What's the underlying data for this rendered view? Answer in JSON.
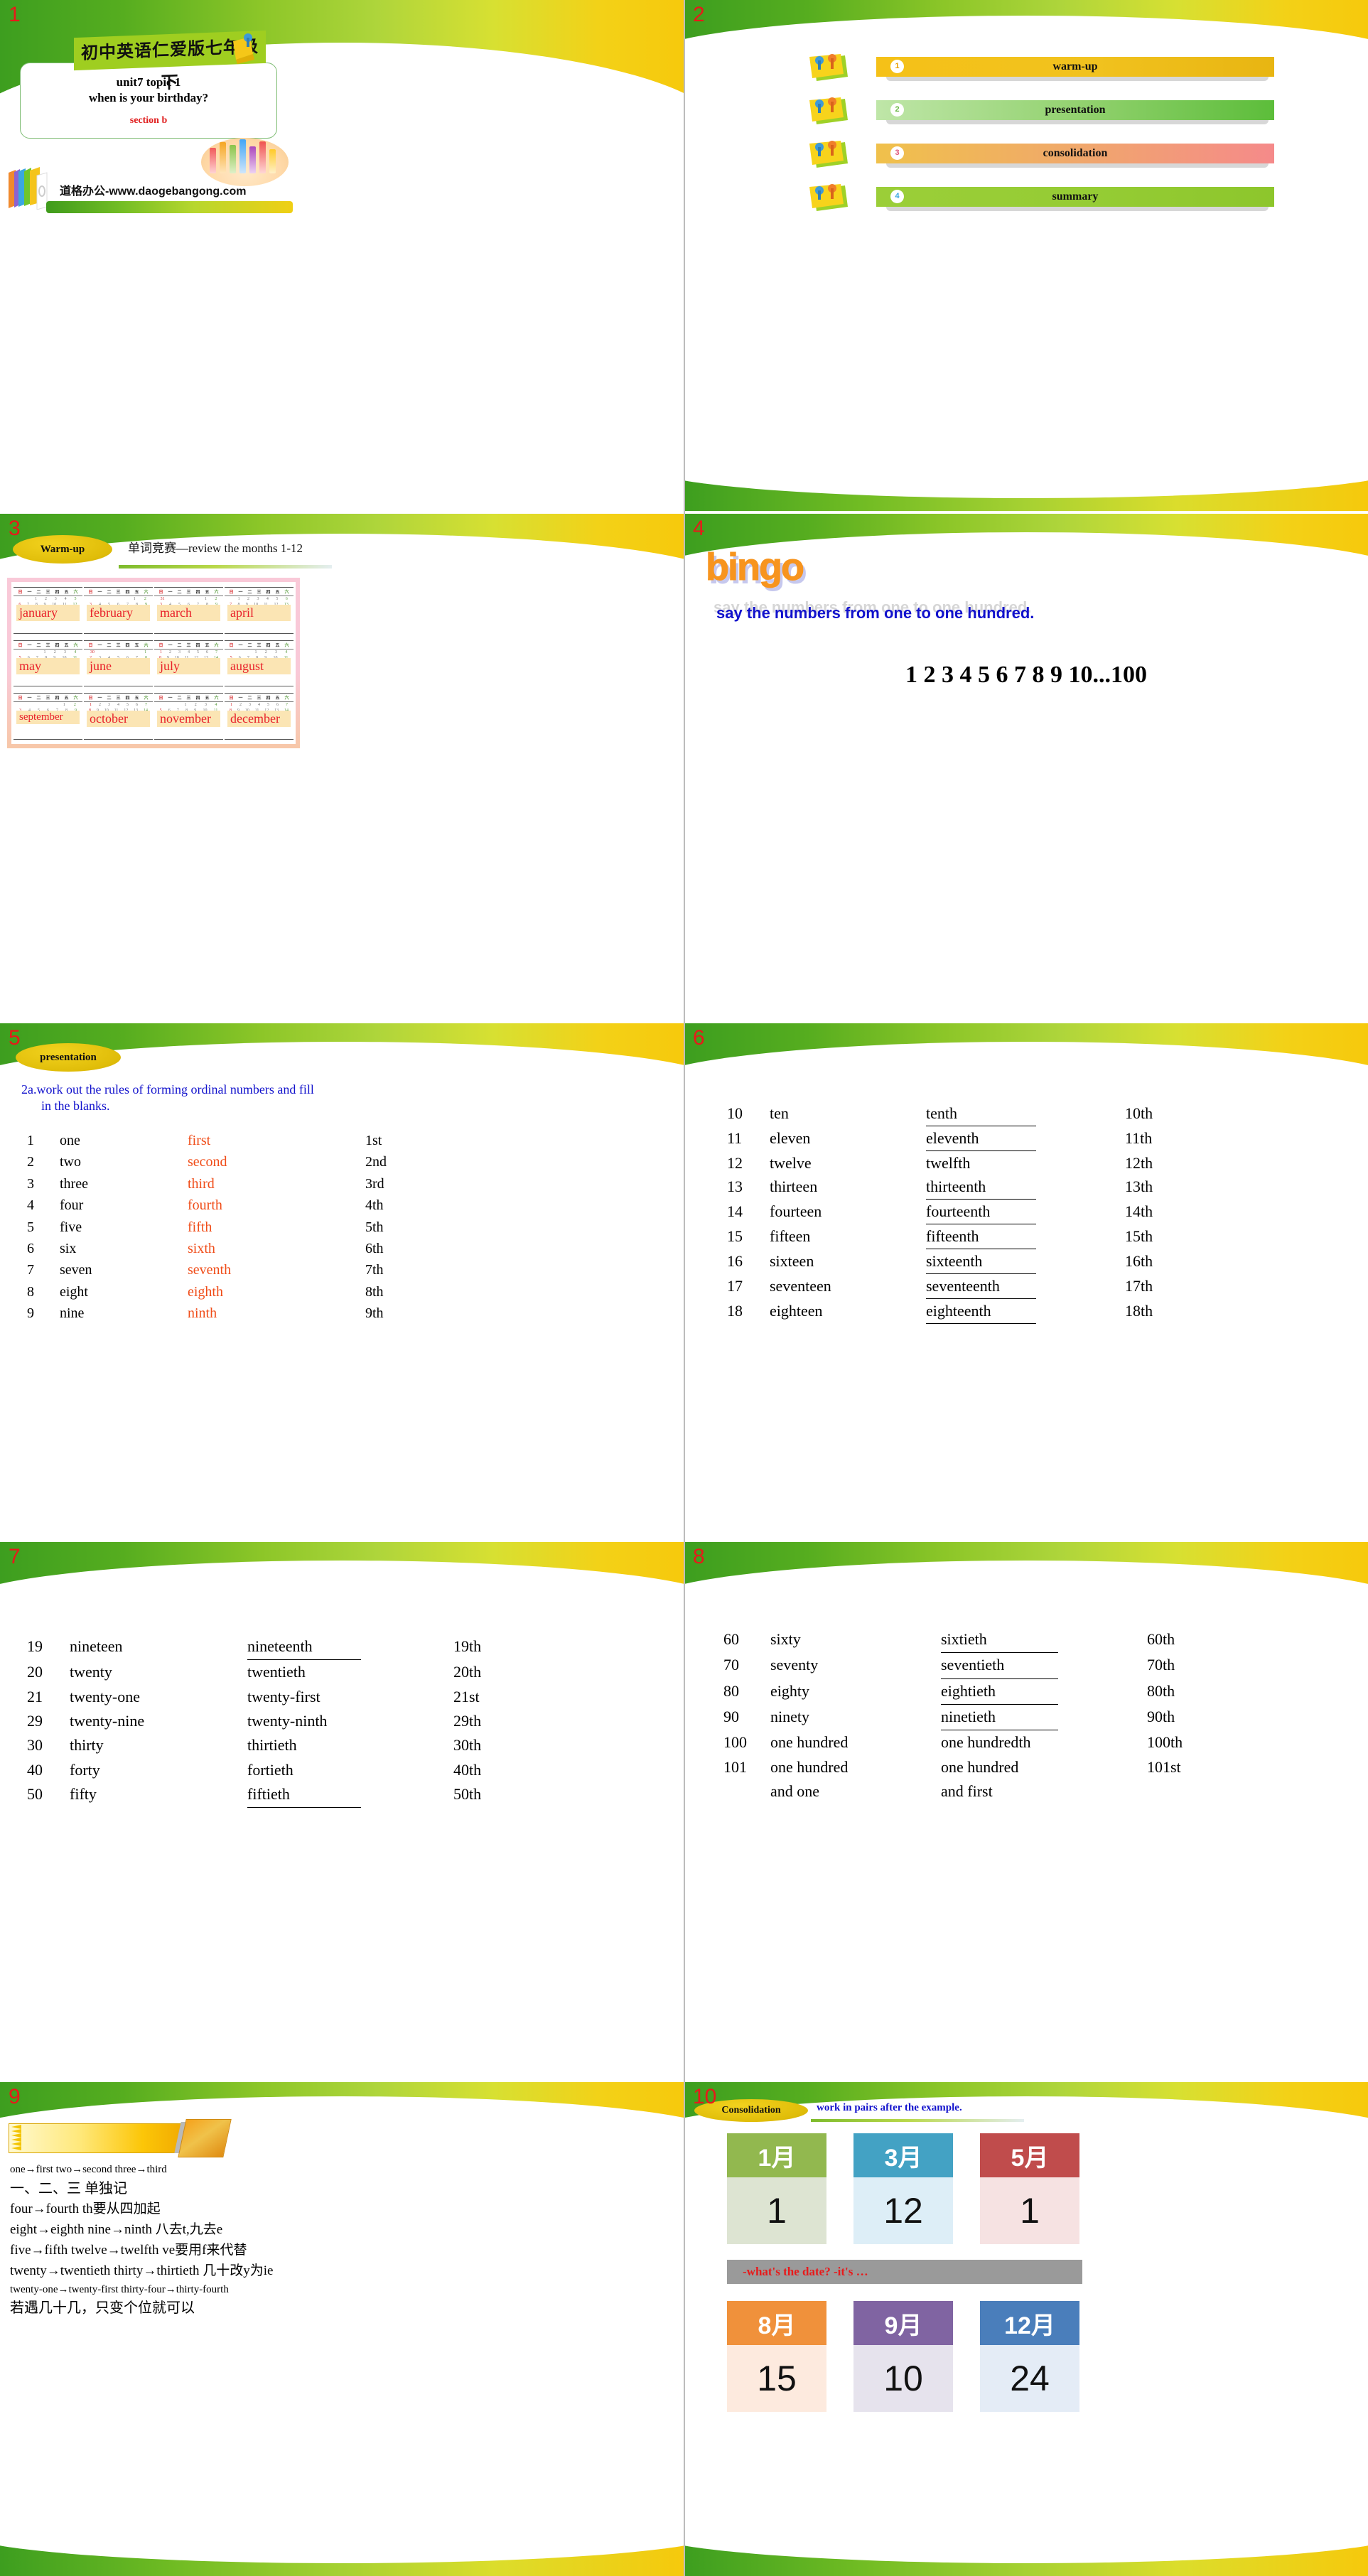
{
  "deck": {
    "watermark": "道格办公-www.daogebangong.com"
  },
  "slide1": {
    "number": "1",
    "banner": "初中英语仁爱版七年级下",
    "line1": "unit7 topic 1",
    "line2": "when is your birthday?",
    "line3": "section b"
  },
  "slide2": {
    "number": "2",
    "items": [
      {
        "num": "1",
        "label": "warm-up"
      },
      {
        "num": "2",
        "label": "presentation"
      },
      {
        "num": "3",
        "label": "consolidation"
      },
      {
        "num": "4",
        "label": "summary"
      }
    ]
  },
  "slide3": {
    "number": "3",
    "title": "Warm-up",
    "subtitle": "单词竞赛—review the months 1-12",
    "weekdays": [
      "日",
      "一",
      "二",
      "三",
      "四",
      "五",
      "六"
    ],
    "months": [
      {
        "label": "january",
        "days": [
          "",
          "",
          "1",
          "2",
          "3",
          "4",
          "5"
        ],
        "days2": [
          "6",
          "7",
          "8",
          "9",
          "10",
          "11",
          "12"
        ]
      },
      {
        "label": "february",
        "days": [
          "",
          "",
          "",
          "",
          "",
          "1",
          "2"
        ],
        "days2": [
          "3",
          "4",
          "5",
          "6",
          "7",
          "8",
          "9"
        ]
      },
      {
        "label": "march",
        "days": [
          "31",
          "",
          "",
          "",
          "",
          "1",
          "2"
        ],
        "days2": [
          "3",
          "4",
          "5",
          "6",
          "7",
          "8",
          "9"
        ]
      },
      {
        "label": "april",
        "days": [
          "",
          "1",
          "2",
          "3",
          "4",
          "5",
          "6"
        ],
        "days2": [
          "7",
          "8",
          "9",
          "10",
          "11",
          "12",
          "13"
        ]
      },
      {
        "label": "may",
        "days": [
          "",
          "",
          "",
          "1",
          "2",
          "3",
          "4"
        ],
        "days2": [
          "5",
          "6",
          "7",
          "8",
          "9",
          "10",
          "11"
        ]
      },
      {
        "label": "june",
        "days": [
          "30",
          "",
          "",
          "",
          "",
          "",
          "1"
        ],
        "days2": [
          "2",
          "3",
          "4",
          "5",
          "6",
          "7",
          "8"
        ]
      },
      {
        "label": "july",
        "days": [
          "1",
          "2",
          "3",
          "4",
          "5",
          "6",
          "7"
        ],
        "days2": [
          "8",
          "9",
          "10",
          "11",
          "12",
          "13",
          "14"
        ]
      },
      {
        "label": "august",
        "days": [
          "",
          "",
          "",
          "1",
          "2",
          "3",
          "4"
        ],
        "days2": [
          "5",
          "6",
          "7",
          "8",
          "9",
          "10",
          "11"
        ]
      },
      {
        "label": "september",
        "days": [
          "",
          "",
          "",
          "",
          "",
          "1",
          "2"
        ],
        "days2": [
          "3",
          "4",
          "5",
          "6",
          "7",
          "8",
          "9"
        ]
      },
      {
        "label": "october",
        "days": [
          "1",
          "2",
          "3",
          "4",
          "5",
          "6",
          "7"
        ],
        "days2": [
          "8",
          "9",
          "10",
          "11",
          "12",
          "13",
          "14"
        ]
      },
      {
        "label": "november",
        "days": [
          "",
          "",
          "",
          "1",
          "2",
          "3",
          "4"
        ],
        "days2": [
          "5",
          "6",
          "7",
          "8",
          "9",
          "10",
          "11"
        ]
      },
      {
        "label": "december",
        "days": [
          "1",
          "2",
          "3",
          "4",
          "5",
          "6",
          "7"
        ],
        "days2": [
          "8",
          "9",
          "10",
          "11",
          "12",
          "13",
          "14"
        ]
      }
    ]
  },
  "slide4": {
    "number": "4",
    "title": "bingo",
    "instruction": "say the numbers from one to one hundred.",
    "numbers": "1 2 3 4 5 6 7 8 9 10...100"
  },
  "slide5": {
    "number": "5",
    "title": "presentation",
    "instruction_line1": "2a.work out the rules of forming ordinal numbers and fill",
    "instruction_line2": "in the blanks.",
    "rows": [
      {
        "n": "1",
        "word": "one",
        "ordinal": "first",
        "abbr": "1st",
        "underline": false
      },
      {
        "n": "2",
        "word": "two",
        "ordinal": "second",
        "abbr": "2nd",
        "underline": false
      },
      {
        "n": "3",
        "word": "three",
        "ordinal": "third",
        "abbr": "3rd",
        "underline": false
      },
      {
        "n": "4",
        "word": "four",
        "ordinal": "fourth",
        "abbr": "4th",
        "underline": false
      },
      {
        "n": "5",
        "word": "five",
        "ordinal": "fifth",
        "abbr": "5th",
        "underline": false
      },
      {
        "n": "6",
        "word": "six",
        "ordinal": "sixth",
        "abbr": "6th",
        "underline": false
      },
      {
        "n": "7",
        "word": "seven",
        "ordinal": "seventh",
        "abbr": "7th",
        "underline": false
      },
      {
        "n": "8",
        "word": "eight",
        "ordinal": "eighth",
        "abbr": "8th",
        "underline": false
      },
      {
        "n": "9",
        "word": "nine",
        "ordinal": "ninth",
        "abbr": "9th",
        "underline": false
      }
    ]
  },
  "slide6": {
    "number": "6",
    "rows": [
      {
        "n": "10",
        "word": "ten",
        "ordinal": "tenth",
        "abbr": "10th",
        "underline": true
      },
      {
        "n": "11",
        "word": "eleven",
        "ordinal": "eleventh",
        "abbr": "11th",
        "underline": true
      },
      {
        "n": "12",
        "word": "twelve",
        "ordinal": "twelfth",
        "abbr": "12th",
        "underline": false
      },
      {
        "n": "13",
        "word": "thirteen",
        "ordinal": "thirteenth",
        "abbr": "13th",
        "underline": true
      },
      {
        "n": "14",
        "word": "fourteen",
        "ordinal": "fourteenth",
        "abbr": "14th",
        "underline": true
      },
      {
        "n": "15",
        "word": "fifteen",
        "ordinal": "fifteenth",
        "abbr": "15th",
        "underline": true
      },
      {
        "n": "16",
        "word": "sixteen",
        "ordinal": "sixteenth",
        "abbr": "16th",
        "underline": true
      },
      {
        "n": "17",
        "word": "seventeen",
        "ordinal": "seventeenth",
        "abbr": "17th",
        "underline": true
      },
      {
        "n": "18",
        "word": "eighteen",
        "ordinal": "eighteenth",
        "abbr": "18th",
        "underline": true
      }
    ]
  },
  "slide7": {
    "number": "7",
    "rows": [
      {
        "n": "19",
        "word": "nineteen",
        "ordinal": "nineteenth",
        "abbr": "19th",
        "underline": true
      },
      {
        "n": "20",
        "word": "twenty",
        "ordinal": "twentieth",
        "abbr": "20th",
        "underline": false
      },
      {
        "n": "21",
        "word": "twenty-one",
        "ordinal": "twenty-first",
        "abbr": "21st",
        "underline": false
      },
      {
        "n": "29",
        "word": "twenty-nine",
        "ordinal": "twenty-ninth",
        "abbr": "29th",
        "underline": false
      },
      {
        "n": "30",
        "word": "thirty",
        "ordinal": "thirtieth",
        "abbr": "30th",
        "underline": false
      },
      {
        "n": "40",
        "word": "forty",
        "ordinal": "fortieth",
        "abbr": "40th",
        "underline": false
      },
      {
        "n": "50",
        "word": "fifty",
        "ordinal": "fiftieth",
        "abbr": "50th",
        "underline": true
      }
    ]
  },
  "slide8": {
    "number": "8",
    "rows": [
      {
        "n": "60",
        "word": "sixty",
        "ordinal": "sixtieth",
        "abbr": "60th",
        "underline": true
      },
      {
        "n": "70",
        "word": "seventy",
        "ordinal": "seventieth",
        "abbr": "70th",
        "underline": true
      },
      {
        "n": "80",
        "word": "eighty",
        "ordinal": "eightieth",
        "abbr": "80th",
        "underline": true
      },
      {
        "n": "90",
        "word": "ninety",
        "ordinal": "ninetieth",
        "abbr": "90th",
        "underline": true
      },
      {
        "n": "100",
        "word": "one hundred",
        "ordinal": "one hundredth",
        "abbr": "100th",
        "underline": false
      },
      {
        "n": "101",
        "word": "one hundred",
        "ordinal": "one hundred",
        "abbr": "101st",
        "underline": false
      },
      {
        "n": "",
        "word": "and one",
        "ordinal": "and first",
        "abbr": "",
        "underline": false
      }
    ]
  },
  "slide9": {
    "number": "9",
    "lines": [
      "one→first   two→second   three→third",
      "一、二、三 单独记",
      "four→fourth     th要从四加起",
      "eight→eighth   nine→ninth  八去t,九去e",
      "five→fifth   twelve→twelfth   ve要用f来代替",
      "twenty→twentieth   thirty→thirtieth  几十改y为ie",
      "twenty-one→twenty-first   thirty-four→thirty-fourth",
      "若遇几十几，只变个位就可以"
    ]
  },
  "slide10": {
    "number": "10",
    "title": "Consolidation",
    "subtitle": "work in pairs after the example.",
    "prompt": "-what's the date?     -it's …",
    "cards_top": [
      {
        "month": "1月",
        "day": "1",
        "head_color": "#92b84f",
        "body_color": "#dde4d2"
      },
      {
        "month": "3月",
        "day": "12",
        "head_color": "#43a2c4",
        "body_color": "#ddeef7"
      },
      {
        "month": "5月",
        "day": "1",
        "head_color": "#c04c4c",
        "body_color": "#f6e2e2"
      }
    ],
    "cards_bottom": [
      {
        "month": "8月",
        "day": "15",
        "head_color": "#f0913b",
        "body_color": "#fdeade"
      },
      {
        "month": "9月",
        "day": "10",
        "head_color": "#8064a2",
        "body_color": "#e6e3ed"
      },
      {
        "month": "12月",
        "day": "24",
        "head_color": "#4a7ebb",
        "body_color": "#e4ecf6"
      }
    ]
  },
  "colors": {
    "accent_green": "#7dbb2c",
    "accent_yellow": "#f6c90c",
    "slide_number_red": "#e8191a",
    "ordinal_red": "#f04c18",
    "instruction_blue": "#1111cc",
    "bingo_orange": "#f7941e"
  }
}
